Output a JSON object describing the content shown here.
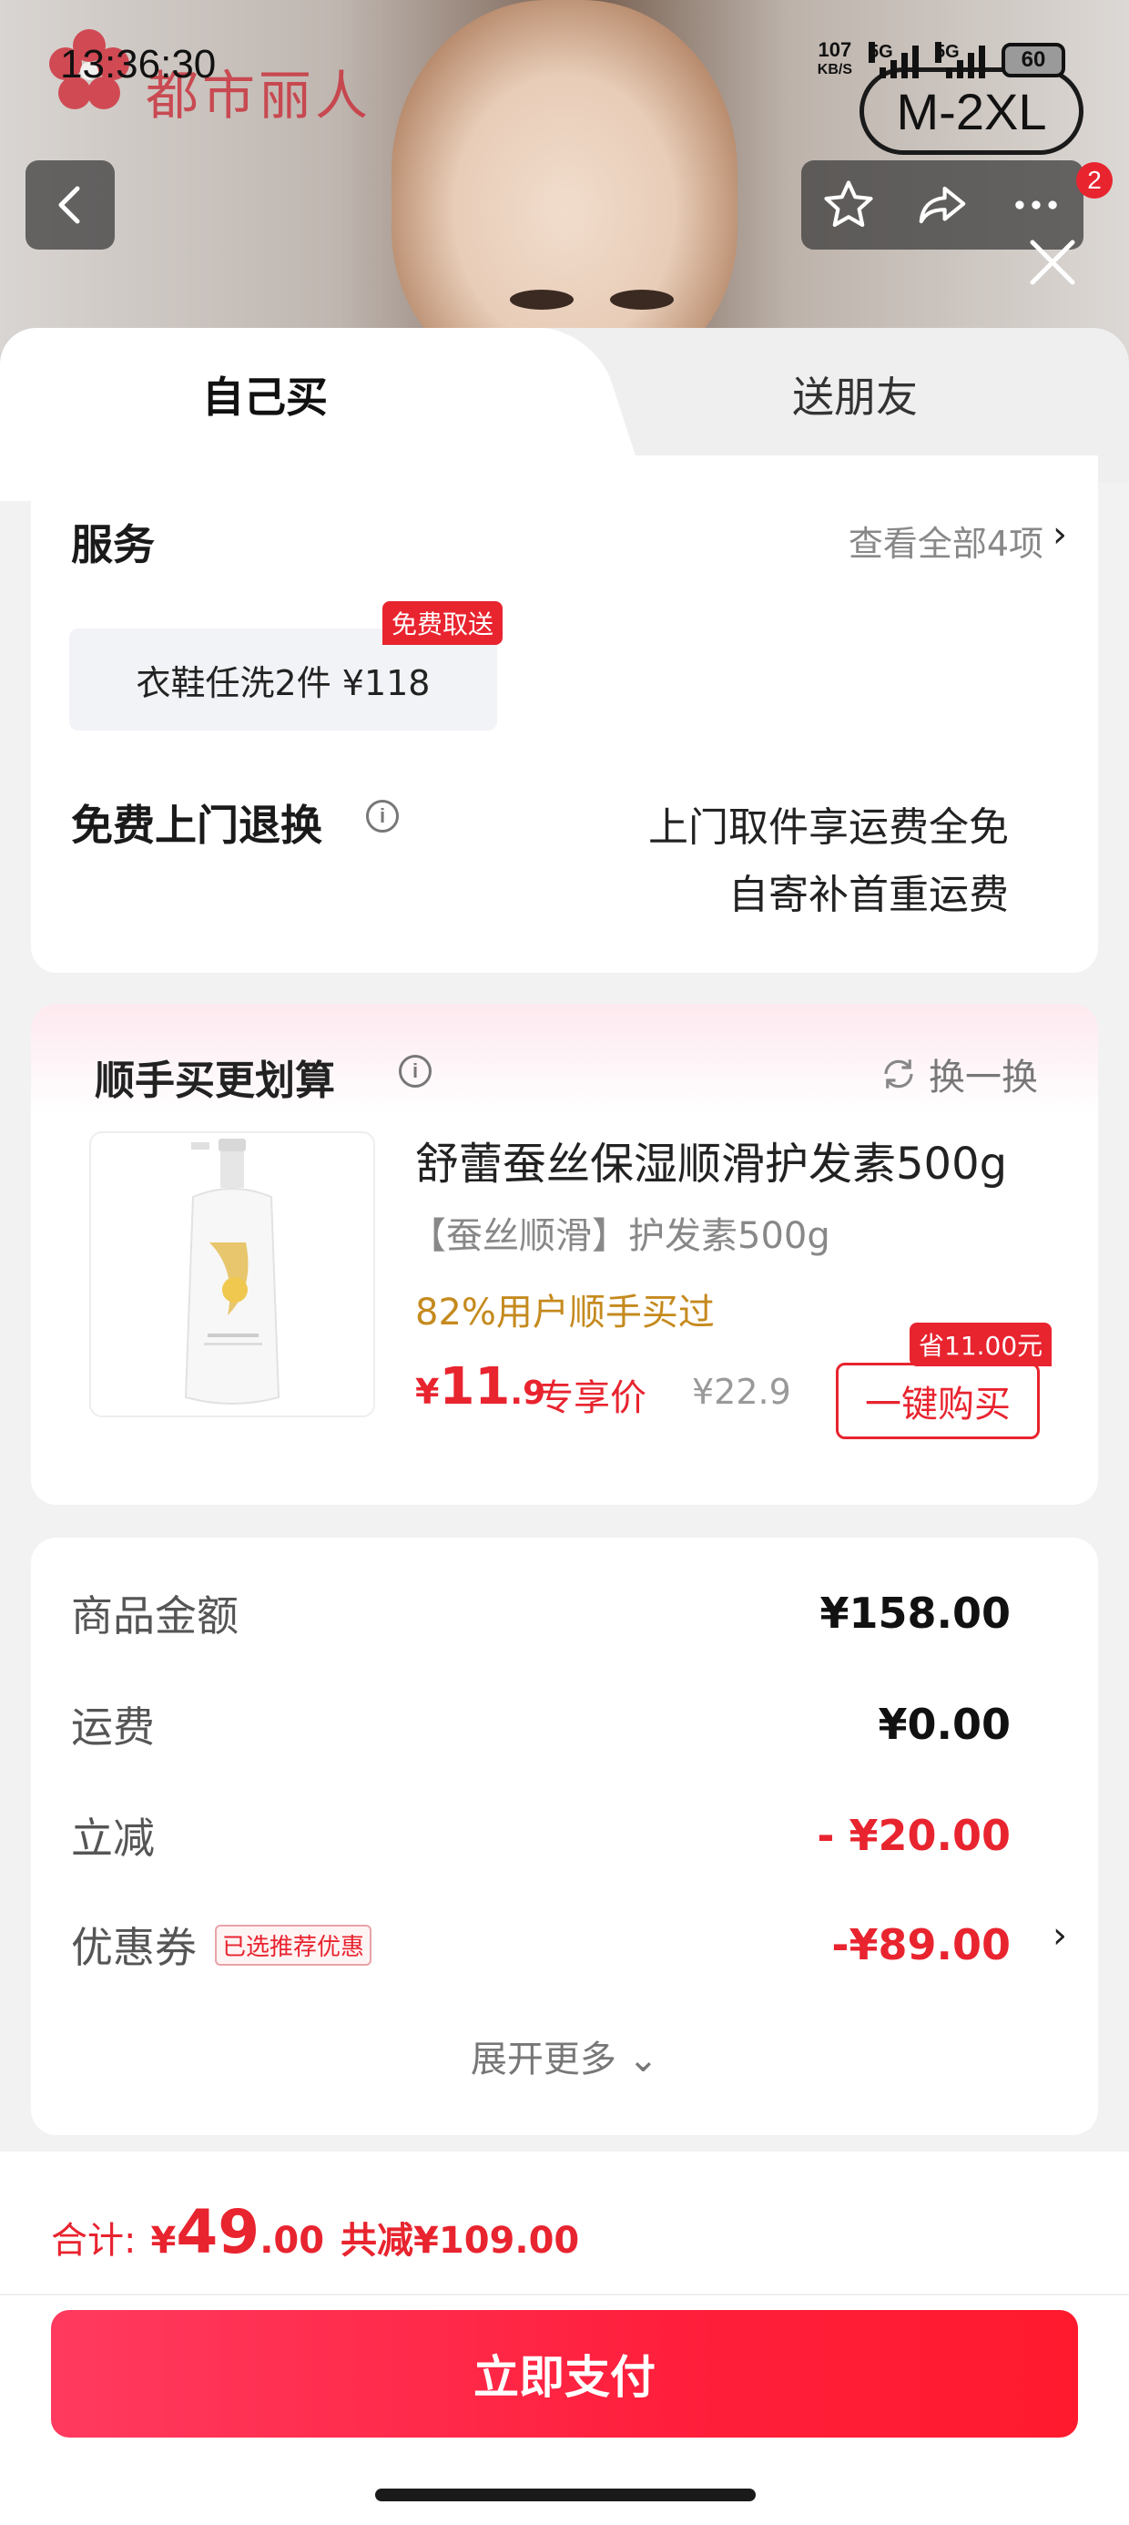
{
  "status_bar": {
    "time": "13:36:30",
    "net_speed_value": "107",
    "net_speed_unit": "KB/S",
    "signal1_label": "5G",
    "signal2_label": "5G",
    "battery": "60"
  },
  "hero": {
    "brand_name": "都市丽人",
    "size_tag": "M-2XL",
    "notification_count": "2"
  },
  "tabs": [
    {
      "label": "自己买",
      "active": true
    },
    {
      "label": "送朋友",
      "active": false
    }
  ],
  "service": {
    "title": "服务",
    "view_all": "查看全部4项",
    "chip_label": "衣鞋任洗2件  ¥118",
    "chip_tag": "免费取送",
    "return_title": "免费上门退换",
    "return_line1": "上门取件享运费全免",
    "return_line2": "自寄补首重运费"
  },
  "upsell": {
    "title": "顺手买更划算",
    "swap_label": "换一换",
    "product_name": "舒蕾蚕丝保湿顺滑护发素500g",
    "product_spec": "【蚕丝顺滑】护发素500g",
    "product_stat": "82%用户顺手买过",
    "price_currency": "¥",
    "price_int": "11",
    "price_dec": ".9",
    "exclusive_label": "专享价",
    "original_price": "¥22.9",
    "buy_label": "一键购买",
    "save_tag": "省11.00元"
  },
  "summary": {
    "rows": [
      {
        "label": "商品金额",
        "value": "¥158.00"
      },
      {
        "label": "运费",
        "value": "¥0.00"
      },
      {
        "label": "立减",
        "value": "- ¥20.00"
      },
      {
        "label": "优惠券",
        "value": "-¥89.00"
      }
    ],
    "coupon_tag": "已选推荐优惠",
    "expand_label": "展开更多"
  },
  "footer": {
    "total_label": "合计:",
    "total_currency": "¥",
    "total_int": "49",
    "total_dec": ".00",
    "total_saved": "共减¥109.00",
    "pay_label": "立即支付"
  },
  "colors": {
    "accent_red": "#e8242f",
    "stat_orange": "#c58a1e"
  }
}
